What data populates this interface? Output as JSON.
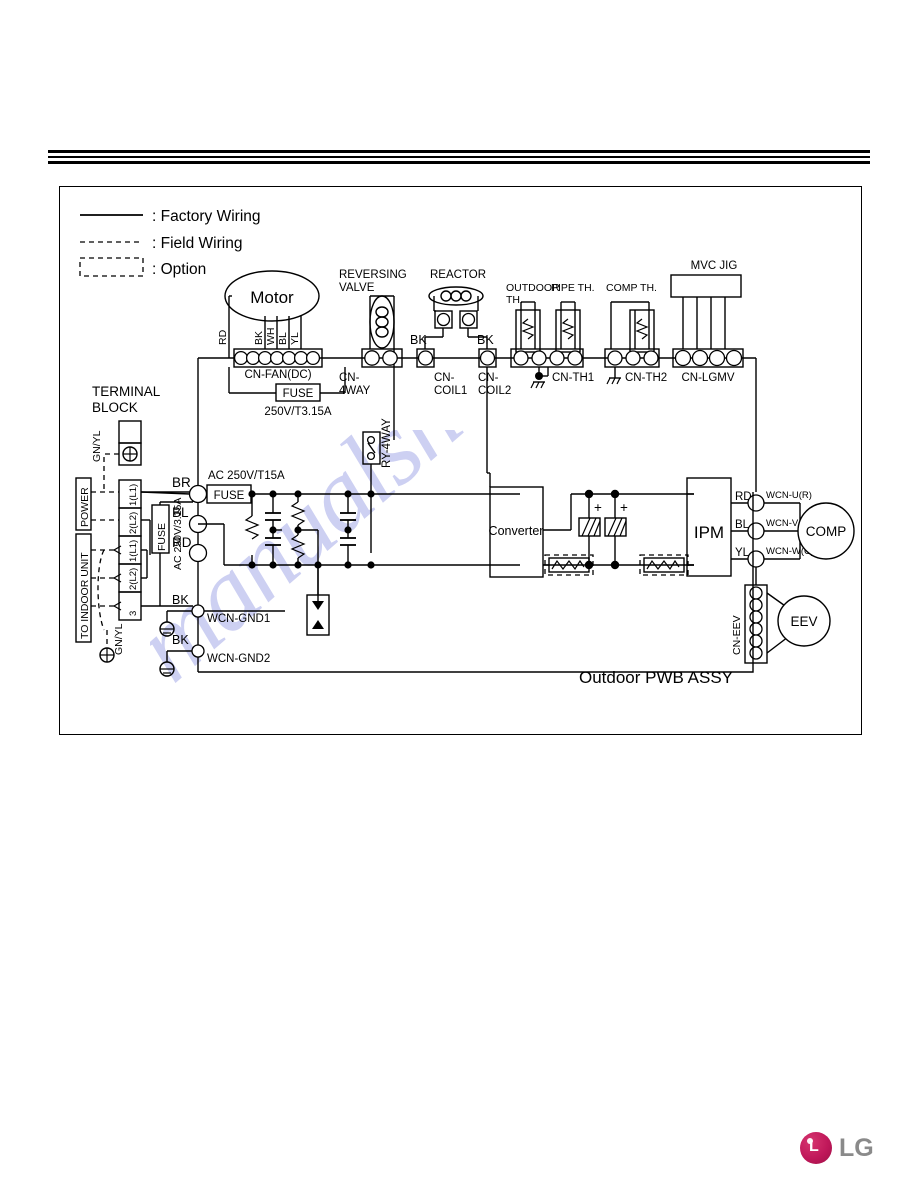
{
  "document": {
    "watermark": "manualshive.com",
    "brand": "LG",
    "brand_mark_color": "#c0185a",
    "brand_text_color": "#8a8a8a"
  },
  "legend": {
    "items": [
      {
        "id": "factory-wiring",
        "style": "solid-line",
        "label": ": Factory Wiring"
      },
      {
        "id": "field-wiring",
        "style": "dashed-line",
        "label": ": Field Wiring"
      },
      {
        "id": "option",
        "style": "dashed-box",
        "label": ": Option"
      }
    ]
  },
  "diagram": {
    "title": "Outdoor PWB ASSY",
    "components": {
      "motor": "Motor",
      "reversing_valve": [
        "REVERSING",
        "VALVE"
      ],
      "reactor": "REACTOR",
      "outdoor_th": [
        "OUTDOOR",
        "TH."
      ],
      "pipe_th": "PIPE TH.",
      "comp_th": "COMP TH.",
      "mvc_jig": "MVC JIG",
      "terminal_block": [
        "TERMINAL",
        "BLOCK"
      ],
      "converter": "Converter",
      "ipm": "IPM",
      "comp": "COMP",
      "eev": "EEV"
    },
    "connectors": {
      "cn_fan": [
        "CN-FAN(DC)"
      ],
      "cn_4way": [
        "CN-",
        "4WAY"
      ],
      "cn_coil1": [
        "CN-",
        "COIL1"
      ],
      "cn_coil2": [
        "CN-",
        "COIL2"
      ],
      "cn_th1": "CN-TH1",
      "cn_th2": "CN-TH2",
      "cn_lgmv": "CN-LGMV",
      "cn_eev": "CN-EEV",
      "ry_4way": "RY-4WAY"
    },
    "wire_labels": {
      "motor_rd": "RD",
      "motor_bk": "BK",
      "motor_wh": "WH",
      "motor_bl": "BL",
      "motor_yl": "YL",
      "coil1_bk": "BK",
      "coil2_bk": "BK",
      "line_br": "BR",
      "line_bl": "BL",
      "line_rd": "RD",
      "gnd_bk1": "BK",
      "gnd_bk2": "BK",
      "ipm_rd": "RD",
      "ipm_bl": "BL",
      "ipm_yl": "YL",
      "gnyl_top": "GN/YL",
      "gnyl_bottom": "GN/YL"
    },
    "fuses": {
      "fan_fuse_label": "FUSE",
      "fan_fuse_rating": "250V/T3.15A",
      "main_fuse_label": "FUSE",
      "main_fuse_rating": "AC 250V/T15A",
      "tb_fuse_label": "FUSE",
      "tb_fuse_rating": "AC 250V/3.15A"
    },
    "terminals": {
      "power_label": "POWER",
      "indoor_label": "TO INDOOR UNIT",
      "pins": [
        "1(L1)",
        "2(L2)",
        "1(L1)",
        "2(L2)",
        "3"
      ]
    },
    "grounds": {
      "wcn_gnd1": "WCN-GND1",
      "wcn_gnd2": "WCN-GND2"
    },
    "comp_terminals": {
      "u": "WCN-U(R)",
      "v": "WCN-V(S)",
      "w": "WCN-W(C)"
    },
    "capacitor_marks": [
      "+",
      "+"
    ]
  }
}
